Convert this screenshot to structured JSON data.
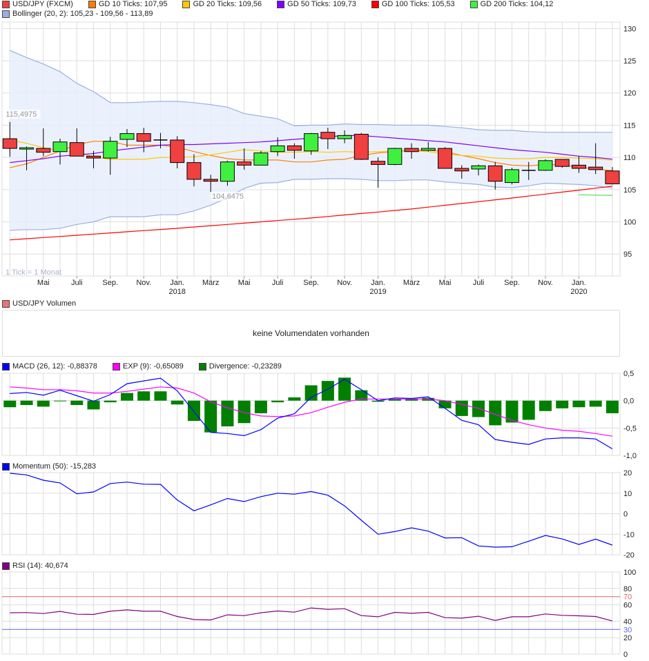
{
  "legend_main": [
    {
      "label": "USD/JPY (FXCM)",
      "color": "#f04040"
    },
    {
      "label": "GD 10 Ticks: 107,95",
      "color": "#ff7f00"
    },
    {
      "label": "GD 20 Ticks: 109,56",
      "color": "#ffc800"
    },
    {
      "label": "GD 50 Ticks: 109,73",
      "color": "#8000ff"
    },
    {
      "label": "GD 100 Ticks: 105,53",
      "color": "#ff0000"
    },
    {
      "label": "GD 200 Ticks: 104,12",
      "color": "#40f040"
    }
  ],
  "legend_bollinger": {
    "label": "Bollinger (20, 2): 105,23 - 109,56 - 113,89",
    "color": "#9ab0e0"
  },
  "legend_volume": {
    "label": "USD/JPY Volumen",
    "color": "#f04040"
  },
  "volume_message": "keine Volumendaten vorhanden",
  "legend_macd": [
    {
      "label": "MACD (26, 12): -0,88378",
      "color": "#0000ff"
    },
    {
      "label": "EXP (9): -0,65089",
      "color": "#ff00ff"
    },
    {
      "label": "Divergence: -0,23289",
      "color": "#008000"
    }
  ],
  "legend_momentum": {
    "label": "Momentum (50): -15,283",
    "color": "#0000ff"
  },
  "legend_rsi": {
    "label": "RSI (14): 40,674",
    "color": "#800080"
  },
  "chart_data": [
    {
      "type": "candlestick",
      "title": "USD/JPY (FXCM)",
      "tick_note": "1 Tick = 1 Monat",
      "annotations": [
        {
          "index": 0,
          "value": 115.4975,
          "label": "115,4975",
          "at": "high"
        },
        {
          "index": 12,
          "value": 104.6475,
          "label": "104,6475",
          "at": "low"
        }
      ],
      "ylim": [
        91.6,
        131
      ],
      "yticks": [
        95,
        100,
        105,
        110,
        115,
        120,
        125,
        130
      ],
      "ytick_labels": [
        "95",
        "100",
        "105",
        "110",
        "115",
        "120",
        "125",
        "130"
      ],
      "x_labels": [
        {
          "index": 2,
          "label": "Mai"
        },
        {
          "index": 4,
          "label": "Juli"
        },
        {
          "index": 6,
          "label": "Sep."
        },
        {
          "index": 8,
          "label": "Nov."
        },
        {
          "index": 10,
          "label": "Jan.",
          "year": "2018"
        },
        {
          "index": 12,
          "label": "März"
        },
        {
          "index": 14,
          "label": "Mai"
        },
        {
          "index": 16,
          "label": "Juli"
        },
        {
          "index": 18,
          "label": "Sep."
        },
        {
          "index": 20,
          "label": "Nov."
        },
        {
          "index": 22,
          "label": "Jan.",
          "year": "2019"
        },
        {
          "index": 24,
          "label": "März"
        },
        {
          "index": 26,
          "label": "Mai"
        },
        {
          "index": 28,
          "label": "Juli"
        },
        {
          "index": 30,
          "label": "Sep."
        },
        {
          "index": 32,
          "label": "Nov."
        },
        {
          "index": 34,
          "label": "Jan.",
          "year": "2020"
        }
      ],
      "ohlc": [
        [
          112.9,
          115.5,
          110.1,
          111.4
        ],
        [
          111.3,
          111.7,
          108.0,
          111.5
        ],
        [
          111.4,
          114.5,
          110.2,
          110.8
        ],
        [
          110.9,
          112.9,
          108.9,
          112.4
        ],
        [
          112.3,
          114.5,
          110.2,
          110.2
        ],
        [
          110.2,
          111.0,
          108.3,
          109.9
        ],
        [
          109.9,
          113.2,
          107.3,
          112.5
        ],
        [
          112.8,
          114.4,
          111.6,
          113.7
        ],
        [
          113.7,
          114.6,
          110.8,
          112.5
        ],
        [
          112.7,
          113.8,
          111.4,
          112.7
        ],
        [
          112.7,
          113.3,
          108.3,
          109.2
        ],
        [
          109.2,
          110.5,
          105.5,
          106.6
        ],
        [
          106.6,
          107.3,
          104.65,
          106.3
        ],
        [
          106.3,
          109.5,
          105.6,
          109.3
        ],
        [
          109.3,
          111.4,
          108.1,
          108.8
        ],
        [
          108.8,
          111.0,
          108.8,
          110.7
        ],
        [
          110.9,
          113.1,
          110.2,
          111.8
        ],
        [
          111.8,
          112.2,
          109.8,
          111.1
        ],
        [
          111.0,
          113.8,
          110.4,
          113.7
        ],
        [
          113.9,
          114.6,
          111.3,
          112.9
        ],
        [
          112.9,
          114.2,
          112.2,
          113.4
        ],
        [
          113.6,
          113.8,
          109.6,
          109.7
        ],
        [
          109.4,
          110.0,
          105.3,
          108.9
        ],
        [
          108.9,
          111.5,
          108.8,
          111.4
        ],
        [
          111.4,
          112.2,
          109.8,
          110.9
        ],
        [
          111.1,
          112.4,
          110.9,
          111.4
        ],
        [
          111.4,
          111.6,
          108.3,
          108.3
        ],
        [
          108.3,
          108.8,
          106.7,
          107.9
        ],
        [
          108.2,
          108.9,
          107.2,
          108.7
        ],
        [
          108.7,
          109.3,
          105.0,
          106.3
        ],
        [
          106.1,
          108.4,
          105.8,
          108.1
        ],
        [
          108.0,
          109.3,
          106.5,
          108.0
        ],
        [
          108.0,
          109.7,
          107.9,
          109.5
        ],
        [
          109.7,
          109.7,
          108.4,
          108.6
        ],
        [
          108.8,
          110.2,
          107.6,
          108.3
        ],
        [
          108.5,
          112.2,
          107.4,
          108.1
        ],
        [
          107.9,
          108.5,
          105.8,
          105.9
        ]
      ],
      "series": [
        {
          "name": "GD 10",
          "color": "#ff7f00",
          "values": [
            108.4,
            109.0,
            110.0,
            111.0,
            112.0,
            112.5,
            112.5,
            111.9,
            111.9,
            111.9,
            111.6,
            110.9,
            110.3,
            109.8,
            109.6,
            109.6,
            109.6,
            109.3,
            109.3,
            109.6,
            109.7,
            110.3,
            110.7,
            110.9,
            111.1,
            111.1,
            110.9,
            110.3,
            109.8,
            109.2,
            108.8,
            108.7,
            108.9,
            108.8,
            108.5,
            108.2,
            107.95
          ]
        },
        {
          "name": "GD 20",
          "color": "#ffc800",
          "values": [
            112.7,
            112.2,
            111.5,
            111.0,
            110.8,
            110.1,
            109.7,
            109.7,
            109.7,
            110.0,
            110.0,
            110.1,
            110.4,
            110.8,
            111.2,
            111.0,
            110.8,
            110.8,
            110.9,
            110.8,
            110.9,
            110.8,
            110.9,
            110.9,
            111.0,
            110.9,
            110.5,
            110.3,
            110.2,
            109.9,
            109.8,
            109.8,
            110.0,
            110.0,
            109.9,
            109.8,
            109.56
          ]
        },
        {
          "name": "GD 50",
          "color": "#8000ff",
          "values": [
            109.2,
            109.5,
            109.8,
            110.2,
            110.4,
            110.6,
            111.0,
            111.3,
            111.6,
            111.9,
            112.0,
            112.0,
            112.1,
            112.2,
            112.3,
            112.4,
            112.6,
            112.8,
            113.0,
            113.2,
            113.4,
            113.4,
            113.2,
            113.0,
            112.8,
            112.6,
            112.4,
            112.1,
            111.8,
            111.5,
            111.2,
            111.0,
            110.8,
            110.5,
            110.2,
            110.0,
            109.73
          ]
        },
        {
          "name": "GD 100",
          "color": "#ff0000",
          "values": [
            97.2,
            97.38,
            97.56,
            97.74,
            97.92,
            98.1,
            98.28,
            98.46,
            98.64,
            98.82,
            99.0,
            99.2,
            99.4,
            99.6,
            99.8,
            100.0,
            100.2,
            100.4,
            100.6,
            100.83,
            101.07,
            101.3,
            101.53,
            101.77,
            102.0,
            102.28,
            102.57,
            102.85,
            103.13,
            103.42,
            103.7,
            104.0,
            104.31,
            104.62,
            104.92,
            105.23,
            105.53
          ]
        },
        {
          "name": "GD 200",
          "color": "#50e050",
          "start_index": 34,
          "values": [
            104.2,
            104.15,
            104.12
          ]
        }
      ],
      "bollinger": {
        "upper": [
          126.6,
          125.5,
          124.5,
          123.3,
          121.5,
          120.2,
          118.5,
          118.5,
          118.6,
          118.7,
          118.7,
          118.5,
          118.2,
          117.8,
          116.8,
          116.4,
          116.0,
          114.9,
          115.0,
          115.0,
          115.2,
          115.1,
          115.1,
          115.0,
          115.0,
          115.0,
          114.8,
          114.6,
          114.3,
          114.2,
          114.2,
          114.0,
          113.9,
          113.9,
          113.9,
          113.9,
          113.89
        ],
        "lower": [
          98.7,
          98.8,
          98.8,
          99.0,
          99.6,
          100.0,
          100.8,
          100.8,
          100.8,
          101.1,
          101.1,
          101.7,
          102.6,
          103.7,
          105.2,
          106.0,
          106.1,
          106.6,
          106.6,
          106.7,
          106.7,
          106.6,
          106.4,
          106.4,
          106.5,
          106.5,
          106.2,
          106.0,
          105.8,
          105.4,
          105.3,
          105.6,
          106.0,
          105.9,
          105.8,
          105.6,
          105.23
        ]
      }
    },
    {
      "type": "line+bar",
      "title": "MACD",
      "ylim": [
        -1.0,
        0.5
      ],
      "yticks": [
        0.5,
        0,
        -0.5,
        -1.0
      ],
      "ytick_labels": [
        "0,5",
        "0,0",
        "-0,5",
        "-1,0"
      ],
      "macd": [
        0.13,
        0.15,
        0.1,
        0.19,
        0.09,
        -0.01,
        0.11,
        0.31,
        0.36,
        0.41,
        0.18,
        -0.2,
        -0.58,
        -0.6,
        -0.64,
        -0.53,
        -0.32,
        -0.24,
        0.06,
        0.21,
        0.39,
        0.2,
        0.0,
        0.05,
        0.04,
        0.07,
        -0.14,
        -0.36,
        -0.44,
        -0.71,
        -0.76,
        -0.8,
        -0.7,
        -0.68,
        -0.68,
        -0.7,
        -0.88
      ],
      "exp": [
        0.25,
        0.23,
        0.2,
        0.2,
        0.18,
        0.14,
        0.14,
        0.17,
        0.21,
        0.25,
        0.23,
        0.14,
        -0.02,
        -0.13,
        -0.22,
        -0.28,
        -0.29,
        -0.28,
        -0.22,
        -0.12,
        -0.03,
        0.03,
        0.03,
        0.03,
        0.03,
        0.03,
        0.0,
        -0.07,
        -0.14,
        -0.25,
        -0.36,
        -0.44,
        -0.5,
        -0.54,
        -0.56,
        -0.6,
        -0.65
      ],
      "divergence": [
        -0.12,
        -0.08,
        -0.11,
        -0.01,
        -0.08,
        -0.16,
        -0.03,
        0.14,
        0.17,
        0.17,
        -0.07,
        -0.37,
        -0.58,
        -0.47,
        -0.41,
        -0.23,
        -0.03,
        0.06,
        0.28,
        0.36,
        0.42,
        0.19,
        -0.02,
        0.03,
        0.03,
        0.05,
        -0.14,
        -0.28,
        -0.3,
        -0.45,
        -0.4,
        -0.35,
        -0.19,
        -0.14,
        -0.12,
        -0.11,
        -0.23
      ]
    },
    {
      "type": "line",
      "title": "Momentum (50)",
      "ylim": [
        -20,
        20
      ],
      "yticks": [
        20,
        10,
        0,
        -10,
        -20
      ],
      "ytick_labels": [
        "20",
        "10",
        "0",
        "-10",
        "-20"
      ],
      "values": [
        19.7,
        18.9,
        16.3,
        15.0,
        9.7,
        10.6,
        14.7,
        15.4,
        14.4,
        14.3,
        6.7,
        1.4,
        4.3,
        7.4,
        5.9,
        8.3,
        10.0,
        9.5,
        10.8,
        9.0,
        3.8,
        -3.2,
        -10.0,
        -8.7,
        -6.9,
        -8.5,
        -11.8,
        -11.7,
        -15.7,
        -16.3,
        -16.1,
        -13.4,
        -10.6,
        -12.3,
        -15.0,
        -12.4,
        -15.3
      ]
    },
    {
      "type": "line",
      "title": "RSI (14)",
      "ylim": [
        0,
        100
      ],
      "yticks": [
        100,
        80,
        60,
        40,
        20,
        0
      ],
      "ytick_labels": [
        "100",
        "80",
        "60",
        "40",
        "20",
        "0"
      ],
      "levels": [
        {
          "value": 70,
          "label": "70",
          "color": "#e06060"
        },
        {
          "value": 30,
          "label": "30",
          "color": "#6060ff"
        }
      ],
      "values": [
        50.3,
        50.6,
        49.4,
        52.0,
        48.6,
        48.3,
        52.2,
        53.9,
        52.2,
        52.2,
        45.8,
        42.1,
        41.6,
        47.8,
        46.9,
        50.3,
        52.5,
        51.1,
        56.2,
        54.5,
        55.3,
        46.9,
        45.5,
        50.8,
        49.7,
        50.8,
        44.4,
        43.8,
        46.1,
        41.0,
        45.5,
        45.5,
        48.9,
        47.2,
        46.6,
        45.8,
        40.4
      ]
    }
  ]
}
